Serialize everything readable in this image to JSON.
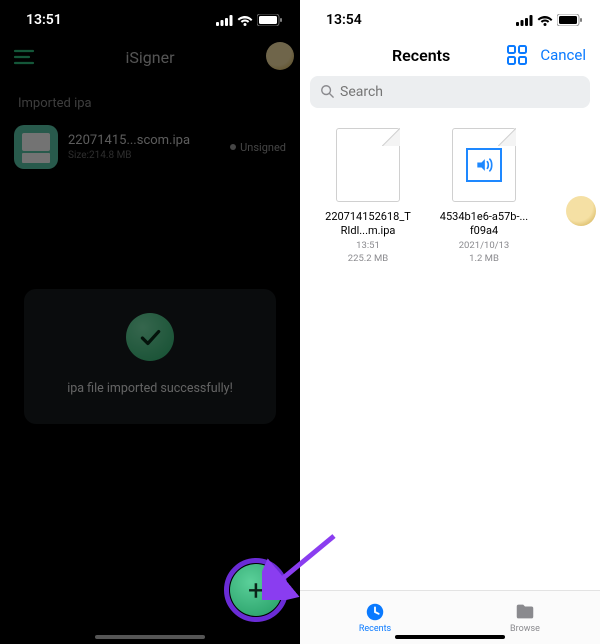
{
  "left": {
    "status_time": "13:51",
    "app_title": "iSigner",
    "section_label": "Imported ipa",
    "ipa": {
      "name": "22071415...scom.ipa",
      "size": "Size:214.8 MB",
      "status": "Unsigned"
    },
    "toast": "ipa file imported successfully!",
    "fab_glyph": "+"
  },
  "right": {
    "status_time": "13:54",
    "header_title": "Recents",
    "cancel_label": "Cancel",
    "search_placeholder": "Search",
    "files": [
      {
        "name": "220714152618_TRIdl...m.ipa",
        "time": "13:51",
        "size": "225.2 MB",
        "kind": "doc"
      },
      {
        "name": "4534b1e6-a57b-...f09a4",
        "time": "2021/10/13",
        "size": "1.2 MB",
        "kind": "audio"
      }
    ],
    "tabs": {
      "recents": "Recents",
      "browse": "Browse"
    }
  }
}
